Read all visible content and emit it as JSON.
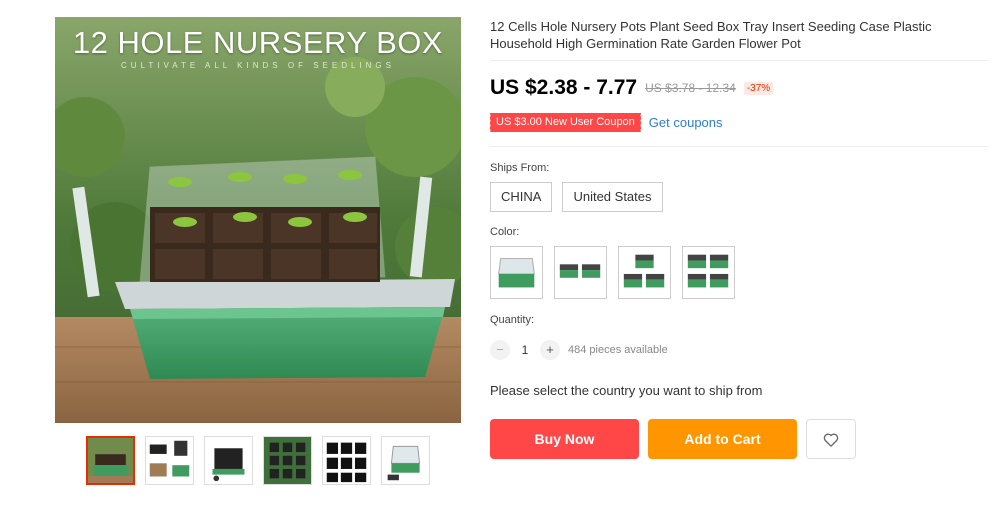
{
  "gallery": {
    "overlay_title": "12 HOLE NURSERY BOX",
    "overlay_subtitle": "CULTIVATE ALL KINDS OF SEEDLINGS",
    "thumbnails": [
      "thumb-1",
      "thumb-2",
      "thumb-3",
      "thumb-4",
      "thumb-5",
      "thumb-6"
    ],
    "active_thumbnail": 0
  },
  "product": {
    "title": "12 Cells Hole Nursery Pots Plant Seed Box Tray Insert Seeding Case Plastic Household High Germination Rate Garden Flower Pot",
    "price": "US $2.38 - 7.77",
    "original_price": "US $3.78 - 12.34",
    "discount": "-37%",
    "coupon": "US $3.00 New User Coupon",
    "get_coupons": "Get coupons"
  },
  "ships_from": {
    "label": "Ships From:",
    "options": [
      "CHINA",
      "United States"
    ]
  },
  "color": {
    "label": "Color:",
    "options": [
      "1 tray",
      "2 trays",
      "3 trays",
      "4 trays"
    ]
  },
  "quantity": {
    "label": "Quantity:",
    "minus": "−",
    "plus": "+",
    "value": "1",
    "available": "484 pieces available"
  },
  "shipping_note": "Please select the country you want to ship from",
  "actions": {
    "buy_now": "Buy Now",
    "add_to_cart": "Add to Cart",
    "wishlist_icon": "heart-icon"
  },
  "colors": {
    "accent_red": "#ff4747",
    "accent_orange": "#ff9500",
    "link_blue": "#2e7bcf",
    "tray_green": "#3f9b5e"
  }
}
